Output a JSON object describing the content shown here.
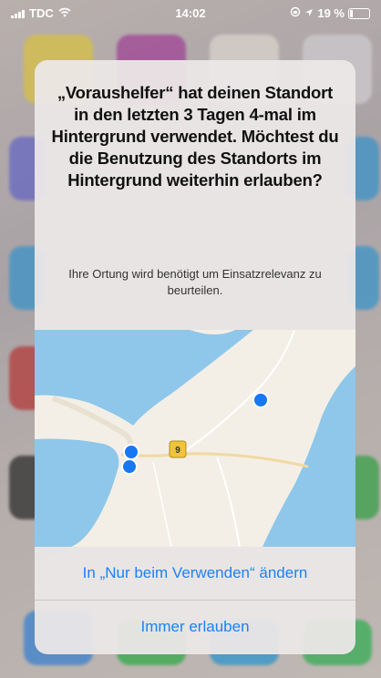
{
  "status_bar": {
    "carrier": "TDC",
    "time": "14:02",
    "battery": "19 %"
  },
  "alert": {
    "title": "„Voraushelfer“ hat deinen Standort in den letzten 3 Tagen 4-mal im Hintergrund verwendet. Möchtest du die Benutzung des Standorts im Hintergrund weiterhin erlauben?",
    "message": "Ihre Ortung wird benötigt um Einsatzrelevanz zu beurteilen.",
    "map": {
      "road_badge": "9",
      "water_color": "#8ec7ea",
      "land_color": "#f3efe6",
      "pin_color": "#1877f2"
    },
    "buttons": {
      "change_label": "In „Nur beim Verwenden“ ändern",
      "allow_label": "Immer erlauben"
    }
  }
}
